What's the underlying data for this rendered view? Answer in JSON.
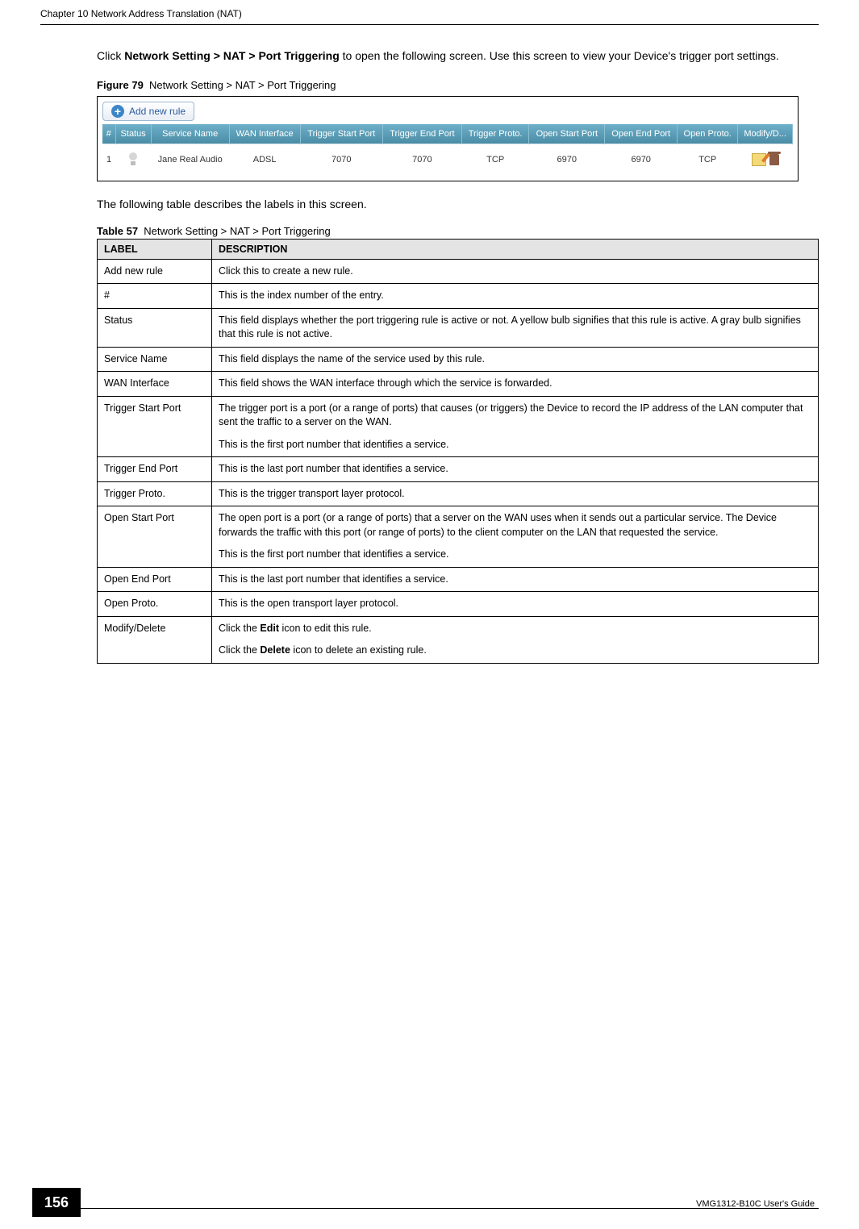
{
  "header": {
    "chapter": "Chapter 10 Network Address Translation (NAT)"
  },
  "intro": {
    "pre": "Click ",
    "path": "Network Setting > NAT > Port Triggering",
    "post": " to open the following screen. Use this screen to view your Device's trigger port settings."
  },
  "figure": {
    "label": "Figure 79",
    "caption": "Network Setting > NAT > Port Triggering"
  },
  "screenshot": {
    "add_button": "Add new rule",
    "columns": [
      "#",
      "Status",
      "Service Name",
      "WAN Interface",
      "Trigger Start Port",
      "Trigger End Port",
      "Trigger Proto.",
      "Open Start Port",
      "Open End Port",
      "Open Proto.",
      "Modify/D..."
    ],
    "row": {
      "num": "1",
      "service_name": "Jane Real Audio",
      "wan_if": "ADSL",
      "t_start": "7070",
      "t_end": "7070",
      "t_proto": "TCP",
      "o_start": "6970",
      "o_end": "6970",
      "o_proto": "TCP"
    }
  },
  "table_intro": "The following table describes the labels in this screen.",
  "desc_table": {
    "caption_label": "Table 57",
    "caption_text": "Network Setting > NAT > Port Triggering",
    "head_label": "LABEL",
    "head_desc": "DESCRIPTION",
    "rows": [
      {
        "label": "Add new rule",
        "desc": "Click this to create a new rule."
      },
      {
        "label": "#",
        "desc": "This is the index number of the entry."
      },
      {
        "label": "Status",
        "desc": "This field displays whether the port triggering rule is active or not. A yellow bulb signifies that this rule is active. A gray bulb signifies that this rule is not active."
      },
      {
        "label": "Service Name",
        "desc": "This field displays the name of the service used by this rule."
      },
      {
        "label": "WAN Interface",
        "desc": "This field shows the WAN interface through which the service is forwarded."
      },
      {
        "label": "Trigger Start Port",
        "desc": "The trigger port is a port (or a range of ports) that causes (or triggers) the Device to record the IP address of the LAN computer that sent the traffic to a server on the WAN.",
        "desc2": "This is the first port number that identifies a service."
      },
      {
        "label": "Trigger End Port",
        "desc": "This is the last port number that identifies a service."
      },
      {
        "label": "Trigger Proto.",
        "desc": "This is the trigger transport layer protocol."
      },
      {
        "label": "Open Start Port",
        "desc": "The open port is a port (or a range of ports) that a server on the WAN uses when it sends out a particular service. The Device forwards the traffic with this port (or range of ports) to the client computer on the LAN that requested the service.",
        "desc2": "This is the first port number that identifies a service."
      },
      {
        "label": "Open End Port",
        "desc": "This is the last port number that identifies a service."
      },
      {
        "label": "Open Proto.",
        "desc": "This is the open transport layer protocol."
      },
      {
        "label": "Modify/Delete",
        "desc_pre": "Click the ",
        "desc_b1": "Edit",
        "desc_mid": " icon to edit this rule.",
        "desc2_pre": "Click the ",
        "desc2_b": "Delete",
        "desc2_post": " icon to delete an existing rule."
      }
    ]
  },
  "footer": {
    "page": "156",
    "guide": "VMG1312-B10C User's Guide"
  }
}
